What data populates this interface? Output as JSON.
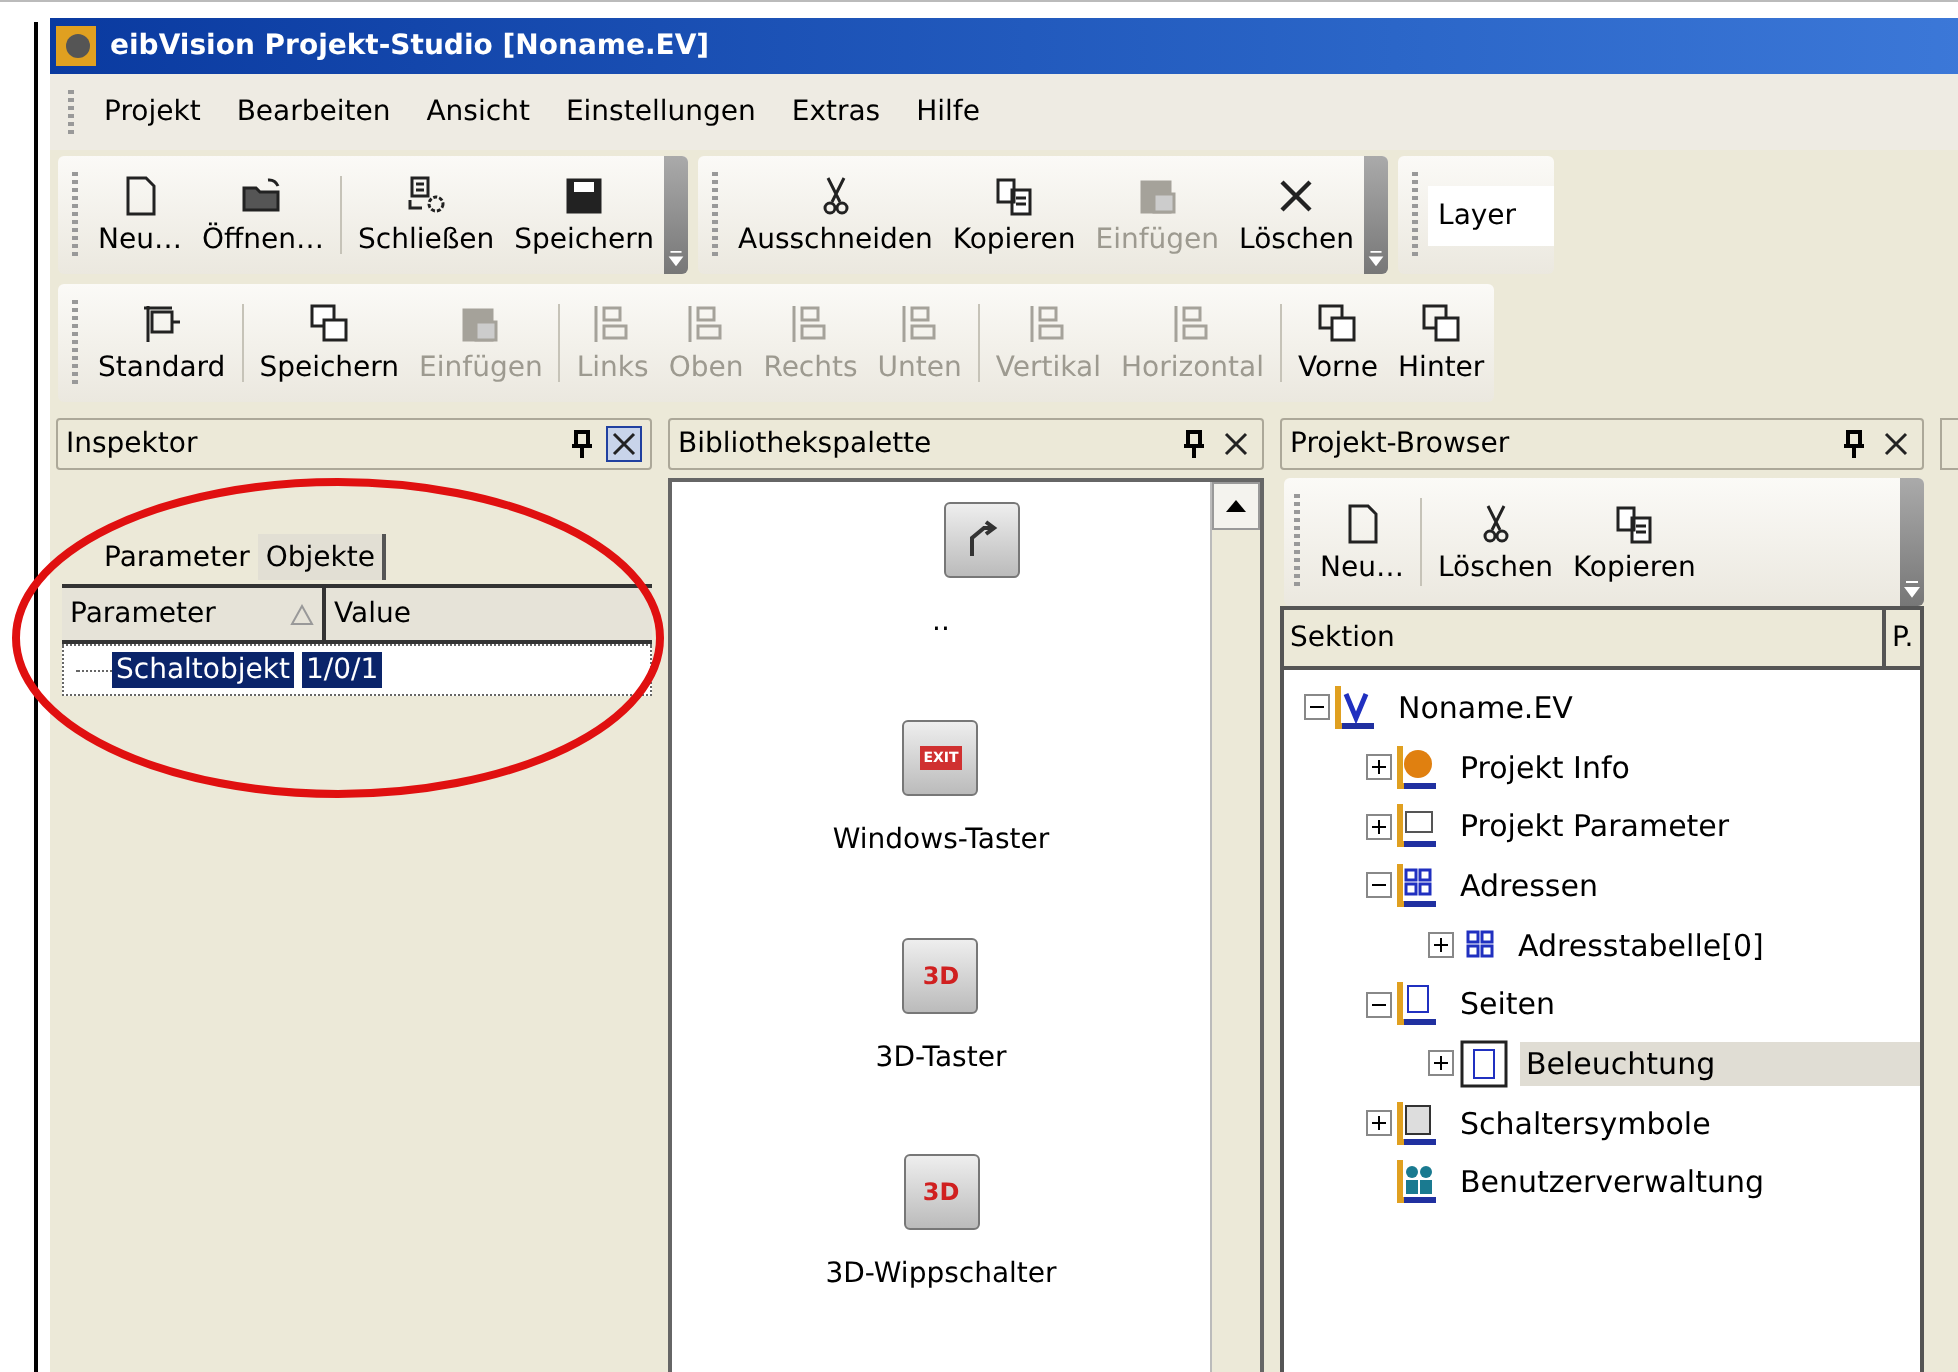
{
  "window": {
    "title": "eibVision Projekt-Studio [Noname.EV]"
  },
  "menu": [
    "Projekt",
    "Bearbeiten",
    "Ansicht",
    "Einstellungen",
    "Extras",
    "Hilfe"
  ],
  "toolbar_1": {
    "groups": [
      [
        {
          "label": "Neu…",
          "kind": "new",
          "disabled": false
        },
        {
          "label": "Öffnen…",
          "kind": "open",
          "disabled": false
        }
      ],
      [
        {
          "label": "Schließen",
          "kind": "close",
          "disabled": false
        },
        {
          "label": "Speichern",
          "kind": "save",
          "disabled": false
        }
      ],
      [
        {
          "label": "Ausschneiden",
          "kind": "cut",
          "disabled": false
        },
        {
          "label": "Kopieren",
          "kind": "copy",
          "disabled": false
        },
        {
          "label": "Einfügen",
          "kind": "paste",
          "disabled": true
        },
        {
          "label": "Löschen",
          "kind": "delete",
          "disabled": false
        }
      ]
    ],
    "layer_field": "Layer"
  },
  "toolbar_2": {
    "groups": [
      [
        {
          "label": "Standard",
          "kind": "frame",
          "disabled": false
        }
      ],
      [
        {
          "label": "Speichern",
          "kind": "store",
          "disabled": false
        },
        {
          "label": "Einfügen",
          "kind": "paste",
          "disabled": true
        }
      ],
      [
        {
          "label": "Links",
          "kind": "align",
          "disabled": true
        },
        {
          "label": "Oben",
          "kind": "align",
          "disabled": true
        },
        {
          "label": "Rechts",
          "kind": "align",
          "disabled": true
        },
        {
          "label": "Unten",
          "kind": "align",
          "disabled": true
        }
      ],
      [
        {
          "label": "Vertikal",
          "kind": "align",
          "disabled": true
        },
        {
          "label": "Horizontal",
          "kind": "align",
          "disabled": true
        }
      ],
      [
        {
          "label": "Vorne",
          "kind": "layers",
          "disabled": false
        },
        {
          "label": "Hinter",
          "kind": "layers",
          "disabled": false
        }
      ]
    ]
  },
  "inspector": {
    "title": "Inspektor",
    "tabs": [
      {
        "label": "Parameter",
        "selected": false
      },
      {
        "label": "Objekte",
        "selected": true
      }
    ],
    "columns": [
      "Parameter",
      "Value"
    ],
    "rows": [
      {
        "parameter": "Schaltobjekt",
        "value": "1/0/1",
        "selected": true
      }
    ]
  },
  "library": {
    "title": "Bibliothekspalette",
    "items": [
      {
        "label": "..",
        "kind": "arrow"
      },
      {
        "label": "Windows-Taster",
        "kind": "exit",
        "badge": "EXIT"
      },
      {
        "label": "3D-Taster",
        "kind": "tile",
        "badge": "3D"
      },
      {
        "label": "3D-Wippschalter",
        "kind": "tile",
        "badge": "3D"
      }
    ]
  },
  "browser": {
    "title": "Projekt-Browser",
    "toolbar": [
      {
        "label": "Neu…",
        "kind": "new"
      },
      {
        "label": "Löschen",
        "kind": "cut"
      },
      {
        "label": "Kopieren",
        "kind": "copy"
      }
    ],
    "columns": [
      "Sektion",
      "P."
    ],
    "tree": [
      {
        "label": "Noname.EV",
        "kind": "project",
        "expanded": true,
        "selected": false,
        "children": [
          {
            "label": "Projekt Info",
            "kind": "info",
            "expanded": false,
            "selected": false
          },
          {
            "label": "Projekt Parameter",
            "kind": "params",
            "expanded": false,
            "selected": false
          },
          {
            "label": "Adressen",
            "kind": "grid",
            "expanded": true,
            "selected": false,
            "children": [
              {
                "label": "Adresstabelle[0]",
                "kind": "table",
                "expanded": false,
                "selected": false
              }
            ]
          },
          {
            "label": "Seiten",
            "kind": "page",
            "expanded": true,
            "selected": false,
            "children": [
              {
                "label": "Beleuchtung",
                "kind": "sheet",
                "expanded": false,
                "selected": true
              }
            ]
          },
          {
            "label": "Schaltersymbole",
            "kind": "switch",
            "expanded": false,
            "selected": false
          },
          {
            "label": "Benutzerverwaltung",
            "kind": "users",
            "selected": false
          }
        ]
      }
    ]
  },
  "annotation": {
    "kind": "ellipse",
    "color": "#e01010"
  }
}
